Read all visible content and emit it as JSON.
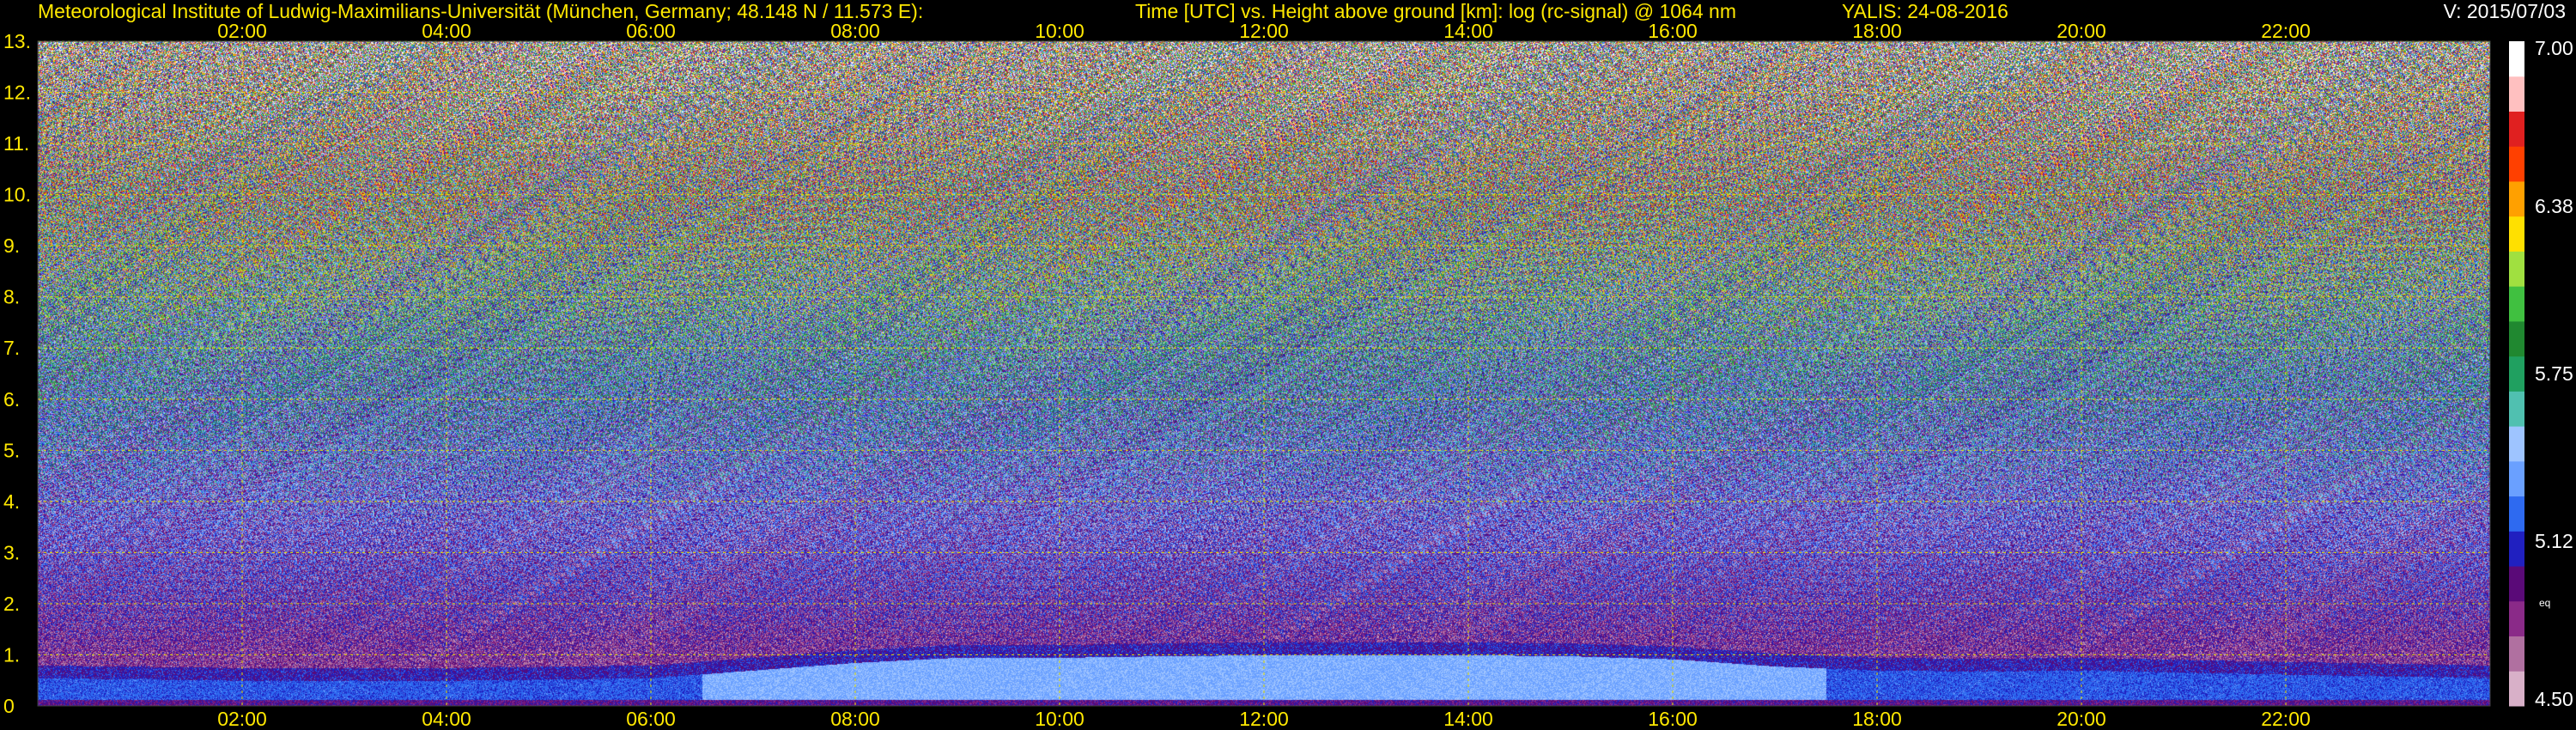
{
  "header": {
    "institute": "Meteorological Institute of Ludwig-Maximilians-Universität (München, Germany; 48.148 N / 11.573 E):",
    "description": "Time [UTC] vs. Height above ground [km]: log (rc-signal) @ 1064 nm",
    "system_date": "YALIS: 24-08-2016",
    "version": "V: 2015/07/03"
  },
  "chart_data": {
    "type": "heatmap",
    "title": "Time [UTC] vs. Height above ground [km]: log (rc-signal) @ 1064 nm",
    "xlabel": "Time [UTC]",
    "ylabel": "Height above ground [km]",
    "xlim": [
      0,
      24
    ],
    "ylim": [
      0,
      13
    ],
    "x_ticks": [
      "02:00",
      "04:00",
      "06:00",
      "08:00",
      "10:00",
      "12:00",
      "14:00",
      "16:00",
      "18:00",
      "20:00",
      "22:00"
    ],
    "x_tick_hours": [
      2,
      4,
      6,
      8,
      10,
      12,
      14,
      16,
      18,
      20,
      22
    ],
    "y_ticks": [
      "0",
      "1.",
      "2.",
      "3.",
      "4.",
      "5.",
      "6.",
      "7.",
      "8.",
      "9.",
      "10.",
      "11.",
      "12.",
      "13."
    ],
    "y_tick_values": [
      0,
      1,
      2,
      3,
      4,
      5,
      6,
      7,
      8,
      9,
      10,
      11,
      12,
      13
    ],
    "grid": true,
    "colorbar": {
      "min": 4.5,
      "max": 7.0,
      "labels": [
        "7.00",
        "6.38",
        "5.75",
        "5.12",
        "4.50"
      ],
      "label_values": [
        7.0,
        6.38,
        5.75,
        5.12,
        4.5
      ],
      "unit_label": "eq",
      "colors": [
        "#d8b0c8",
        "#b070a0",
        "#8a2a88",
        "#5a0a78",
        "#2020c0",
        "#2e6af0",
        "#6aa0ff",
        "#9ec4ff",
        "#50c0b0",
        "#20a060",
        "#208830",
        "#40c040",
        "#a0e040",
        "#ffe000",
        "#ffa000",
        "#ff4000",
        "#e02020",
        "#ffc0c0",
        "#ffffff"
      ]
    },
    "boundary_layer_top_km": [
      [
        0,
        0.55
      ],
      [
        2,
        0.5
      ],
      [
        4,
        0.5
      ],
      [
        6,
        0.55
      ],
      [
        7,
        0.7
      ],
      [
        8,
        0.85
      ],
      [
        9,
        0.95
      ],
      [
        10,
        0.95
      ],
      [
        11,
        0.98
      ],
      [
        12,
        1.0
      ],
      [
        13,
        1.0
      ],
      [
        14,
        1.0
      ],
      [
        15,
        0.98
      ],
      [
        16,
        0.92
      ],
      [
        17,
        0.78
      ],
      [
        18,
        0.7
      ],
      [
        19,
        0.68
      ],
      [
        20,
        0.7
      ],
      [
        21,
        0.66
      ],
      [
        22,
        0.62
      ],
      [
        24,
        0.55
      ]
    ]
  }
}
